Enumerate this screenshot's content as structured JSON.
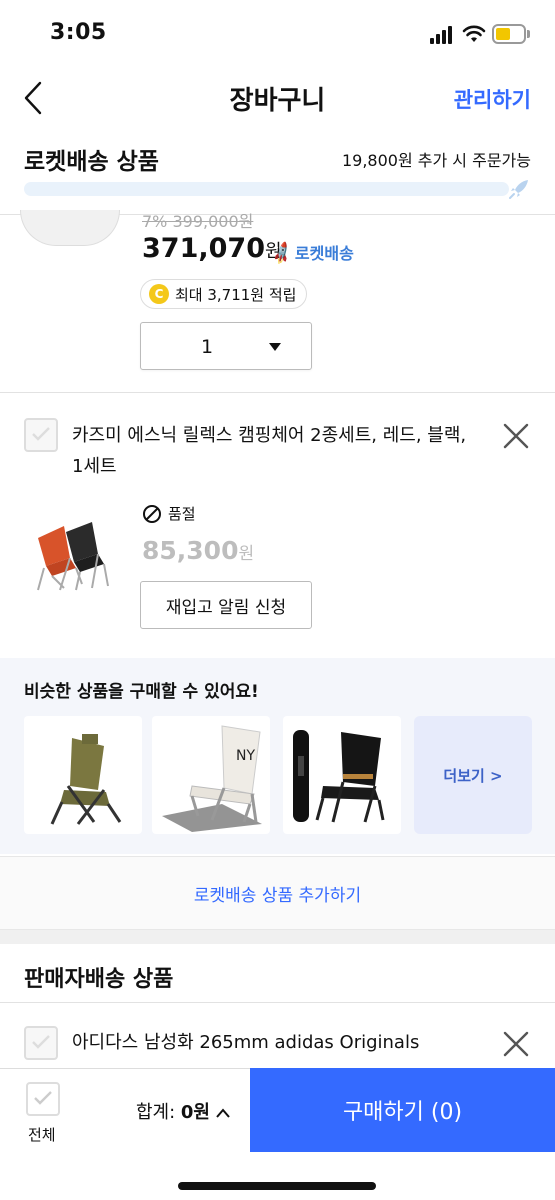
{
  "status_bar": {
    "time": "3:05",
    "signal_icon": "cellular-signal-icon",
    "wifi_icon": "wifi-icon",
    "battery_icon": "battery-icon",
    "battery_color": "#f2c600"
  },
  "header": {
    "title": "장바구니",
    "manage_label": "관리하기",
    "accent": "#346aff"
  },
  "rocket_section": {
    "title": "로켓배송 상품",
    "threshold_text": "19,800원 추가 시 주문가능",
    "progress": 0.0
  },
  "items": [
    {
      "strike_text": "7% 399,000원",
      "price": "371,070",
      "unit": "원",
      "delivery_badge": "로켓배송",
      "cashback": "최대 3,711원 적립",
      "cashback_coin": "C",
      "quantity": "1"
    },
    {
      "name": "카즈미 에스닉 릴렉스 캠핑체어 2종세트, 레드, 블랙, 1세트",
      "status": "품절",
      "price": "85,300",
      "unit": "원",
      "restock_label": "재입고 알림 신청"
    }
  ],
  "similar": {
    "title": "비슷한 상품을 구매할 수 있어요!",
    "more_label": "더보기 >"
  },
  "add_rocket_label": "로켓배송 상품 추가하기",
  "seller_section": {
    "title": "판매자배송 상품",
    "item_name": "아디다스 남성화 265mm adidas Originals"
  },
  "bottom_bar": {
    "all_label": "전체",
    "total_label": "합계: ",
    "total_value": "0원",
    "buy_label": "구매하기 (0)"
  }
}
